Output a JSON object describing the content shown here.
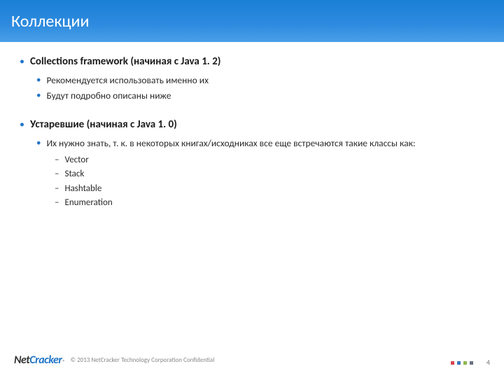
{
  "title": "Коллекции",
  "sections": [
    {
      "heading": "Collections framework (начиная с Java 1. 2)",
      "items": [
        {
          "text": "Рекомендуется использовать именно их"
        },
        {
          "text": "Будут подробно описаны ниже"
        }
      ]
    },
    {
      "heading": "Устаревшие (начиная с Java 1. 0)",
      "items": [
        {
          "text": "Их нужно знать, т. к. в некоторых книгах/исходниках все еще встречаются такие классы как:",
          "subitems": [
            "Vector",
            "Stack",
            "Hashtable",
            "Enumeration"
          ]
        }
      ]
    }
  ],
  "footer": {
    "logo_net": "Net",
    "logo_cracker": "Cracker",
    "logo_r": "®",
    "copyright": "© 2013 NetCracker Technology Corporation Confidential",
    "dots": [
      "#d64550",
      "#3c78c0",
      "#8fb84f",
      "#6a7280"
    ],
    "page_number": "4"
  }
}
